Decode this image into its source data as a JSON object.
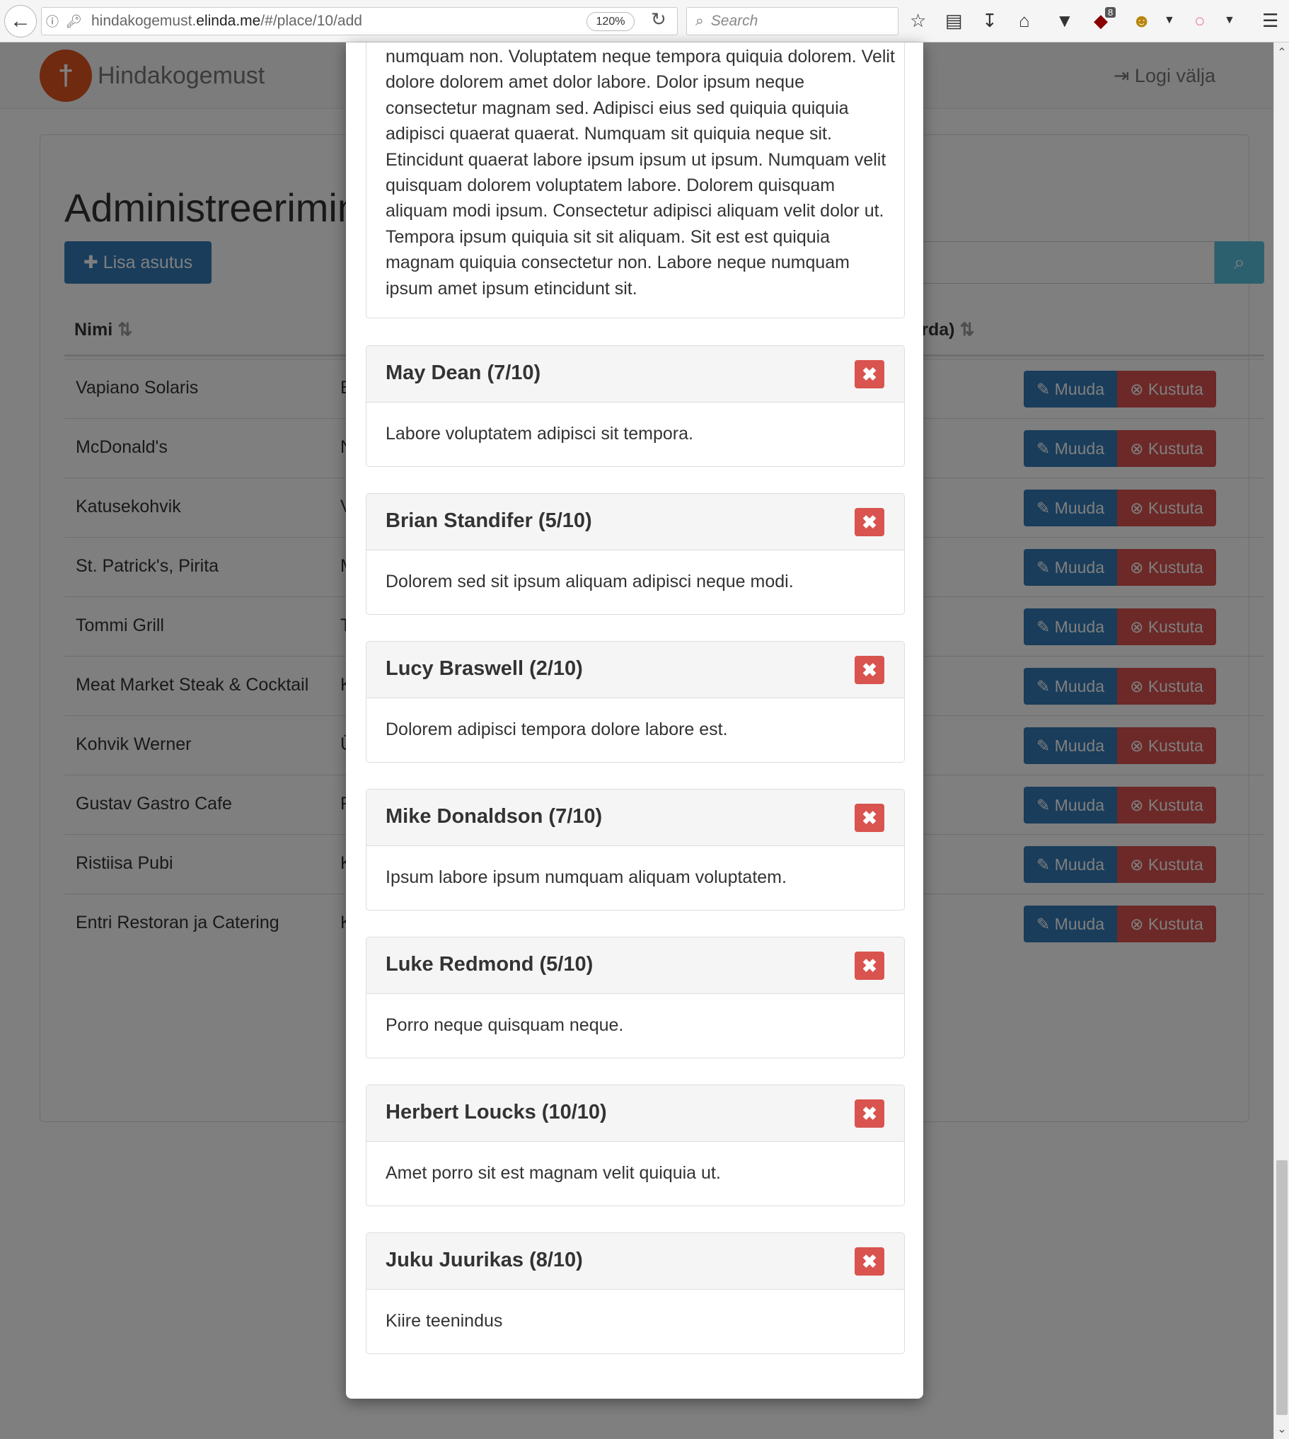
{
  "browser": {
    "url_prefix": "hindakogemust.",
    "url_domain": "elinda.me",
    "url_path": "/#/place/10/add",
    "zoom": "120%",
    "search_placeholder": "Search",
    "ublock_count": "8"
  },
  "navbar": {
    "brand": "Hindakogemust",
    "logout": "Logi välja"
  },
  "admin": {
    "title": "Administreerimine",
    "add_button": "Lisa asutus",
    "col_name": "Nimi",
    "col_rating_suffix": "orda)",
    "edit_label": "Muuda",
    "delete_label": "Kustuta",
    "rows": [
      {
        "name": "Vapiano Solaris",
        "addr": "E"
      },
      {
        "name": "McDonald's",
        "addr": "N"
      },
      {
        "name": "Katusekohvik",
        "addr": "V"
      },
      {
        "name": "St. Patrick's, Pirita",
        "addr": "M"
      },
      {
        "name": "Tommi Grill",
        "addr": "T"
      },
      {
        "name": "Meat Market Steak & Cocktail",
        "addr": "K"
      },
      {
        "name": "Kohvik Werner",
        "addr": "Ü"
      },
      {
        "name": "Gustav Gastro Cafe",
        "addr": "F"
      },
      {
        "name": "Ristiisa Pubi",
        "addr": "K"
      },
      {
        "name": "Entri Restoran ja Catering",
        "addr": "K"
      }
    ]
  },
  "modal": {
    "intro_text": "numquam non. Voluptatem neque tempora quiquia dolorem. Velit dolore dolorem amet dolor labore. Dolor ipsum neque consectetur magnam sed. Adipisci eius sed quiquia quiquia adipisci quaerat quaerat. Numquam sit quiquia neque sit. Etincidunt quaerat labore ipsum ipsum ut ipsum. Numquam velit quisquam dolorem voluptatem labore. Dolorem quisquam aliquam modi ipsum. Consectetur adipisci aliquam velit dolor ut. Tempora ipsum quiquia sit sit aliquam. Sit est est quiquia magnam quiquia consectetur non. Labore neque numquam ipsum amet ipsum etincidunt sit.",
    "reviews": [
      {
        "title": "May Dean (7/10)",
        "body": "Labore voluptatem adipisci sit tempora."
      },
      {
        "title": "Brian Standifer (5/10)",
        "body": "Dolorem sed sit ipsum aliquam adipisci neque modi."
      },
      {
        "title": "Lucy Braswell (2/10)",
        "body": "Dolorem adipisci tempora dolore labore est."
      },
      {
        "title": "Mike Donaldson (7/10)",
        "body": "Ipsum labore ipsum numquam aliquam voluptatem."
      },
      {
        "title": "Luke Redmond (5/10)",
        "body": "Porro neque quisquam neque."
      },
      {
        "title": "Herbert Loucks (10/10)",
        "body": "Amet porro sit est magnam velit quiquia ut."
      },
      {
        "title": "Juku Juurikas (8/10)",
        "body": "Kiire teenindus"
      }
    ]
  }
}
